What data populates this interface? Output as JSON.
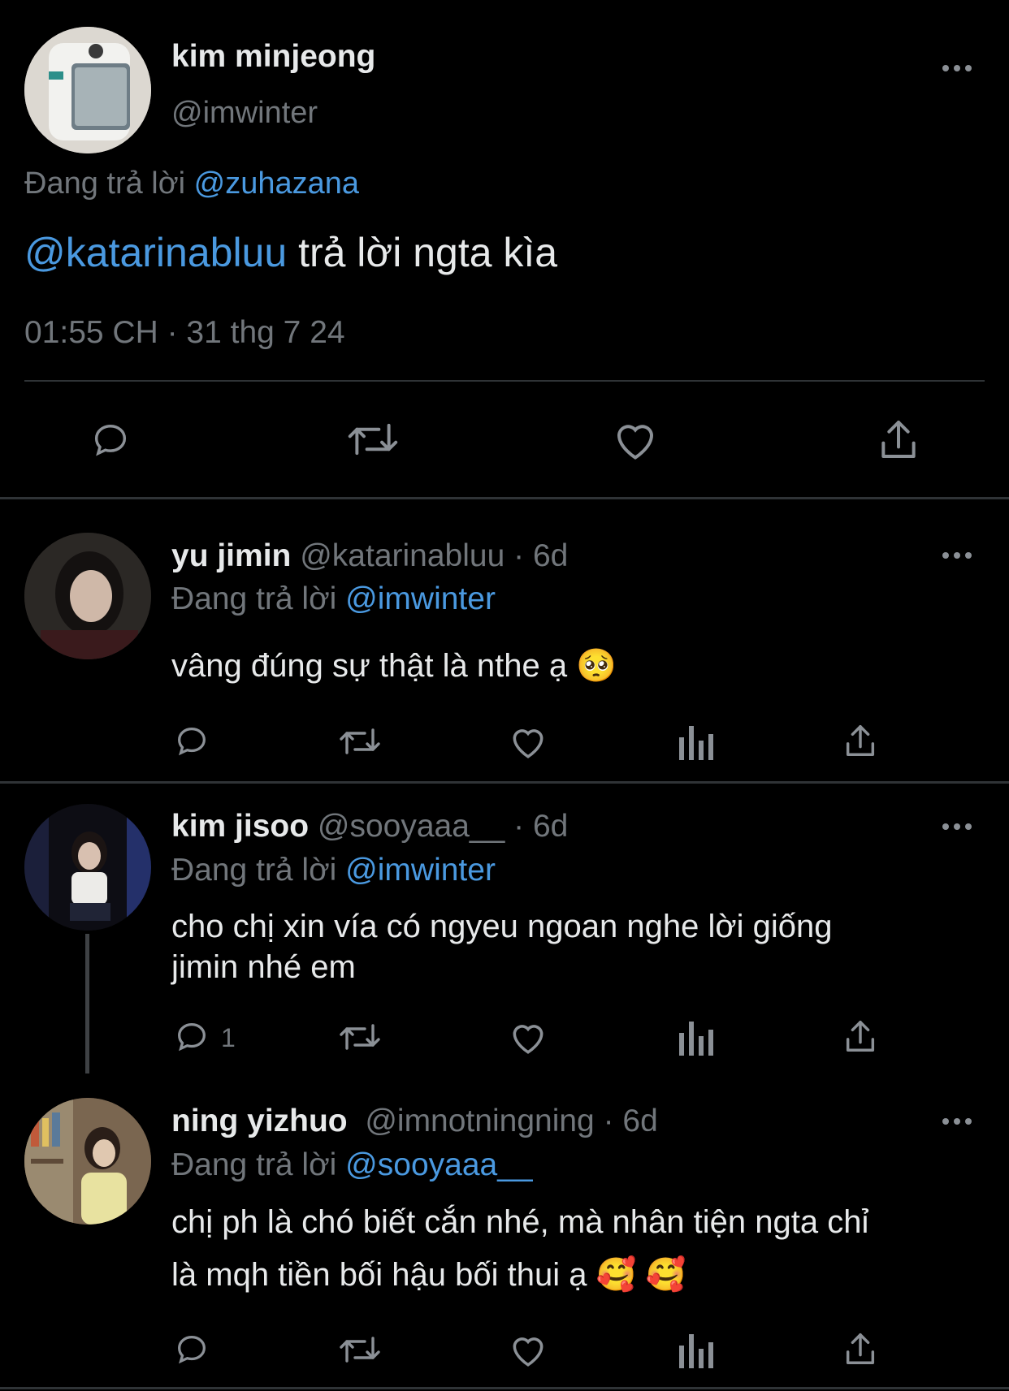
{
  "main_tweet": {
    "name": "kim minjeong",
    "handle": "@imwinter",
    "replying_prefix": "Đang trả lời",
    "replying_to": "@zuhazana",
    "mention": "@katarinabluu",
    "text": " trả lời ngta kìa",
    "timestamp": "01:55 CH · 31 thg 7 24"
  },
  "replies": [
    {
      "name": "yu jimin",
      "handle": "@katarinabluu",
      "time": "· 6d",
      "replying_prefix": "Đang trả lời",
      "replying_to": "@imwinter",
      "text": "vâng đúng sự thật là nthe ạ 🥺",
      "reply_count": ""
    },
    {
      "name": "kim jisoo",
      "handle": "@sooyaaa__",
      "time": "· 6d",
      "replying_prefix": "Đang trả lời",
      "replying_to": "@imwinter",
      "text_line1": "cho chị xin vía có ngyeu ngoan nghe lời giống",
      "text_line2": "jimin nhé em",
      "reply_count": "1"
    },
    {
      "name": "ning yizhuo",
      "handle": "@imnotningning",
      "time": "· 6d",
      "replying_prefix": "Đang trả lời",
      "replying_to": "@sooyaaa__",
      "text_line1": "chị ph là chó biết cắn nhé, mà nhân tiện ngta chỉ",
      "text_line2": "là mqh tiền bối hậu bối thui ạ 🥰 🥰",
      "reply_count": ""
    }
  ],
  "colors": {
    "background": "#000000",
    "text": "#e7e9ea",
    "secondary": "#71767b",
    "link": "#4a99e0",
    "divider": "#2f3336"
  },
  "icons": [
    "reply-icon",
    "retweet-icon",
    "like-icon",
    "views-icon",
    "share-icon",
    "more-icon"
  ]
}
